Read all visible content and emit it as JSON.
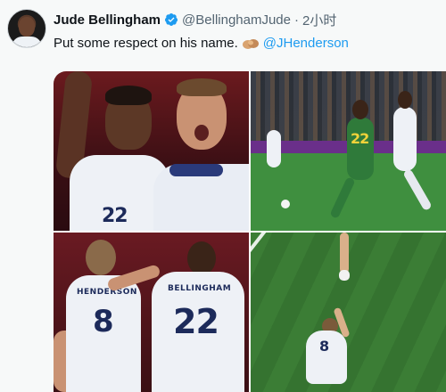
{
  "tweet": {
    "author_name": "Jude Bellingham",
    "handle": "@BellinghamJude",
    "separator": "·",
    "time": "2小时",
    "text": "Put some respect on his name.",
    "mention": "@JHenderson",
    "verified_icon": "verified-badge-icon",
    "emoji_icon": "clapping-hands-emoji-icon"
  },
  "media": {
    "photos": [
      {
        "jersey_number": "22"
      },
      {
        "jersey_number": "22"
      },
      {
        "jersey_number": "8",
        "jersey_name": "HENDERSON",
        "jersey_number_2": "22",
        "jersey_name_2": "BELLINGHAM"
      },
      {
        "jersey_number": "8"
      }
    ]
  },
  "colors": {
    "link": "#1d9bf0",
    "verified": "#1d9bf0",
    "secondary_text": "#536471",
    "background": "#f7f9f9"
  }
}
